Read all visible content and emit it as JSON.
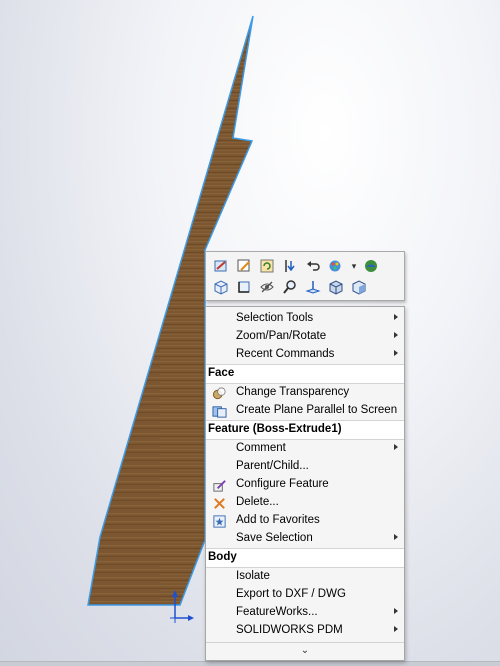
{
  "viewport": {
    "model_color": "#7b5630",
    "edge_color": "#3b9be8",
    "background_colors": [
      "#ffffff",
      "#d2d6e0"
    ]
  },
  "mini_toolbar": {
    "row1": [
      "edit-sketch-icon",
      "edit-feature-icon",
      "rebuild-icon",
      "rollback-icon",
      "undo-icon",
      "appearance-icon",
      "scene-icon"
    ],
    "row2": [
      "view-orientation-icon",
      "normal-to-icon",
      "hide-icon",
      "zoom-icon",
      "reference-plane-icon",
      "display-style-icon",
      "section-view-icon"
    ]
  },
  "context_menu": {
    "sections": [
      {
        "items": [
          {
            "label": "Selection Tools",
            "submenu": true
          },
          {
            "label": "Zoom/Pan/Rotate",
            "submenu": true
          },
          {
            "label": "Recent Commands",
            "submenu": true
          }
        ]
      },
      {
        "header": "Face",
        "items": [
          {
            "label": "Change Transparency",
            "icon": "transparency-icon"
          },
          {
            "label": "Create Plane Parallel to Screen",
            "icon": "plane-parallel-icon"
          }
        ]
      },
      {
        "header": "Feature (Boss-Extrude1)",
        "items": [
          {
            "label": "Comment",
            "submenu": true
          },
          {
            "label": "Parent/Child..."
          },
          {
            "label": "Configure Feature",
            "icon": "configure-feature-icon"
          },
          {
            "label": "Delete...",
            "icon": "delete-icon"
          },
          {
            "label": "Add to Favorites",
            "icon": "favorites-icon"
          },
          {
            "label": "Save Selection",
            "submenu": true
          }
        ]
      },
      {
        "header": "Body",
        "items": [
          {
            "label": "Isolate"
          },
          {
            "label": "Export to DXF / DWG"
          },
          {
            "label": "FeatureWorks...",
            "submenu": true
          },
          {
            "label": "SOLIDWORKS PDM",
            "submenu": true
          }
        ]
      }
    ],
    "more_glyph": "⌄"
  }
}
